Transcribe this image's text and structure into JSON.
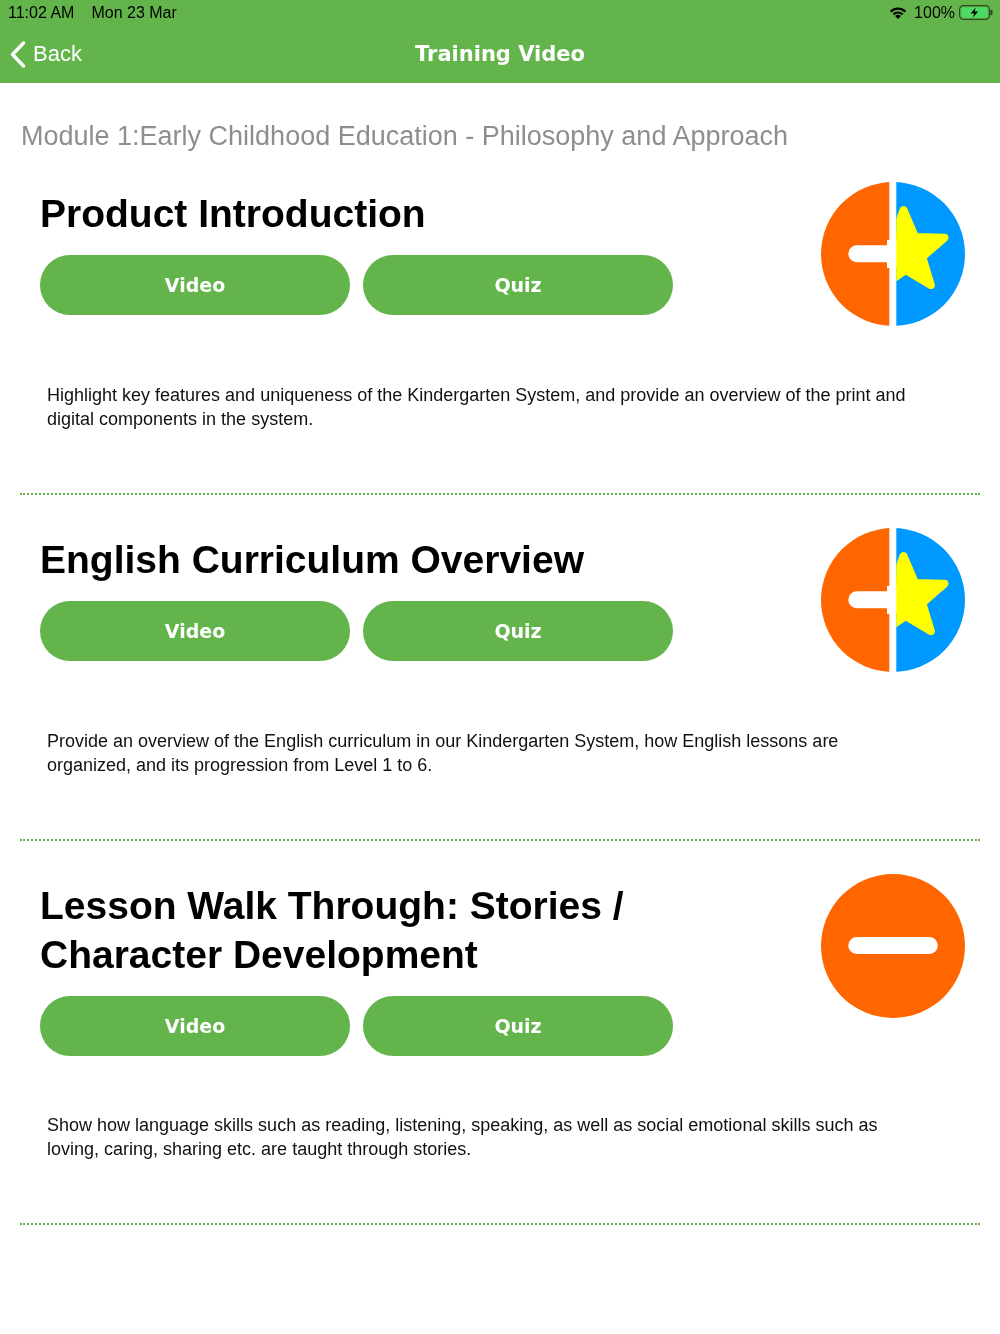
{
  "status_bar": {
    "time": "11:02 AM",
    "date": "Mon 23 Mar",
    "battery": "100%"
  },
  "nav_bar": {
    "back": "Back",
    "title": "Training Video"
  },
  "module_title": "Module 1:Early Childhood Education - Philosophy and Approach",
  "lessons": [
    {
      "title": "Product Introduction",
      "buttons": [
        "Video",
        "Quiz"
      ],
      "star_earned": true,
      "description": "Highlight key features and uniqueness of the Kindergarten System, and provide an overview of the print and digital components in the system."
    },
    {
      "title": "English Curriculum Overview",
      "buttons": [
        "Video",
        "Quiz"
      ],
      "star_earned": true,
      "description": "Provide an overview of the English curriculum in our Kindergarten System, how English lessons are organized, and its progression from Level 1 to 6."
    },
    {
      "title": "Lesson Walk Through: Stories / Character Development",
      "buttons": [
        "Video",
        "Quiz"
      ],
      "star_earned": false,
      "description": "Show how language skills such as reading, listening, speaking, as well as social emotional skills such as loving, caring, sharing etc. are taught through stories."
    }
  ]
}
